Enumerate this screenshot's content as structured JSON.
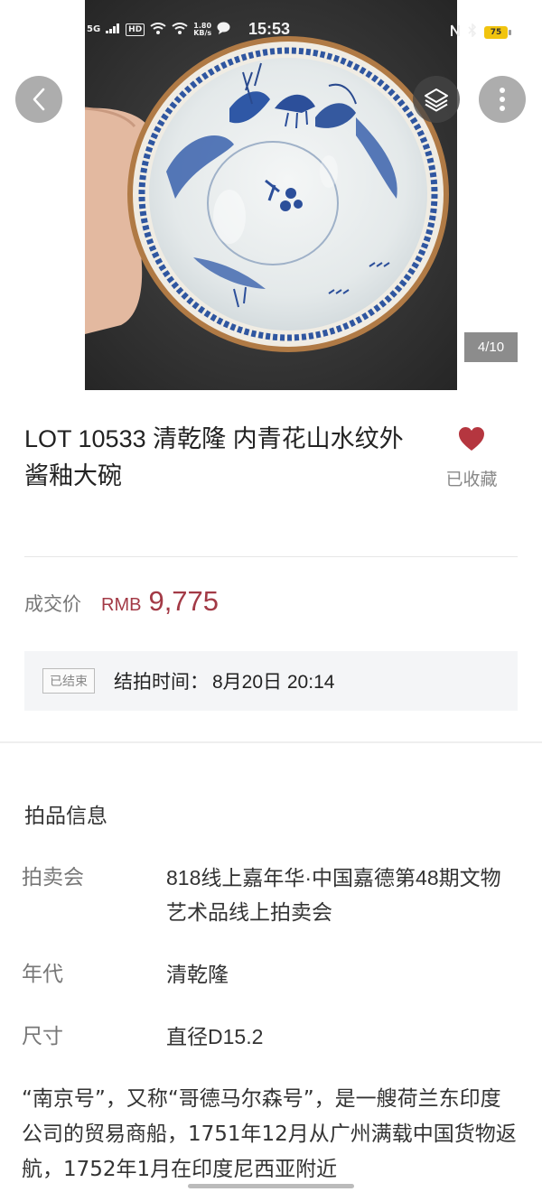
{
  "status_bar": {
    "network": "5G",
    "hd": "HD",
    "speed_value": "1.80",
    "speed_unit": "KB/s",
    "time": "15:53",
    "battery": "75"
  },
  "gallery": {
    "page_indicator": "4/10"
  },
  "lot": {
    "title": "LOT 10533 清乾隆  内青花山水纹外酱釉大碗",
    "favorite_label": "已收藏",
    "favorited": true
  },
  "price": {
    "label": "成交价",
    "currency": "RMB",
    "value": "9,775"
  },
  "auction_status": {
    "tag": "已结束",
    "end_label": "结拍时间：",
    "end_time": "8月20日 20:14"
  },
  "info": {
    "section_title": "拍品信息",
    "rows": [
      {
        "key": "拍卖会",
        "value": "818线上嘉年华·中国嘉德第48期文物艺术品线上拍卖会"
      },
      {
        "key": "年代",
        "value": "清乾隆"
      },
      {
        "key": "尺寸",
        "value": "直径D15.2"
      }
    ],
    "description": "“南京号”，又称“哥德马尔森号”，是一艘荷兰东印度公司的贸易商船，1751年12月从广州满载中国货物返航，1752年1月在印度尼西亚附近"
  },
  "colors": {
    "accent": "#a33a46",
    "heart": "#b5363f",
    "muted": "#888888",
    "status_box_bg": "#f4f5f7"
  },
  "icons": [
    "back-arrow-icon",
    "layers-icon",
    "more-vertical-icon",
    "heart-icon",
    "battery-icon",
    "wifi-icon",
    "bluetooth-icon",
    "nfc-icon",
    "message-icon"
  ]
}
